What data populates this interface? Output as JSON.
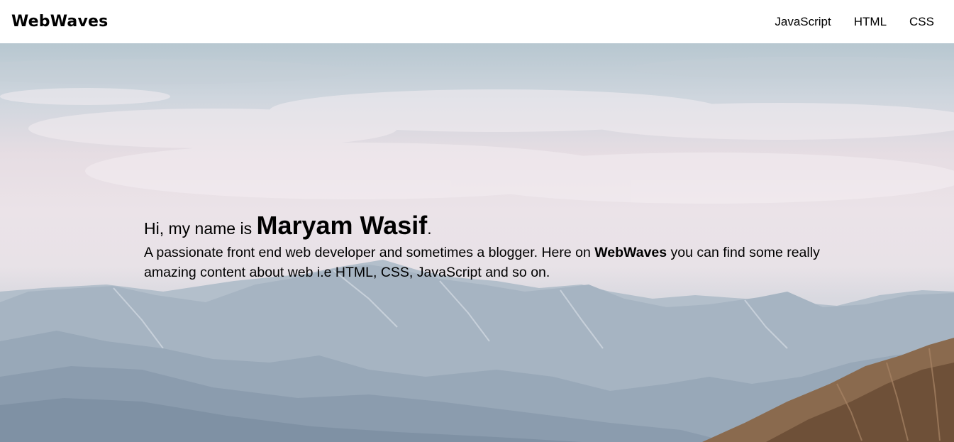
{
  "nav": {
    "brand": "WebWaves",
    "links": [
      {
        "label": "JavaScript"
      },
      {
        "label": "HTML"
      },
      {
        "label": "CSS"
      }
    ]
  },
  "hero": {
    "greeting_prefix": "Hi, my name is ",
    "name": "Maryam Wasif",
    "greeting_suffix": ".",
    "bio_before": "A passionate front end web developer and sometimes a blogger. Here on ",
    "bio_brand": "WebWaves",
    "bio_after": " you can find some really amazing content about web i.e HTML, CSS, JavaScript and so on."
  },
  "colors": {
    "sky_top": "#b7c7d0",
    "cloud": "#ebe3e8",
    "mountain_far": "#a9b6c2",
    "mountain_near": "#8f9fb0",
    "rock_brown": "#8a6a4e"
  }
}
